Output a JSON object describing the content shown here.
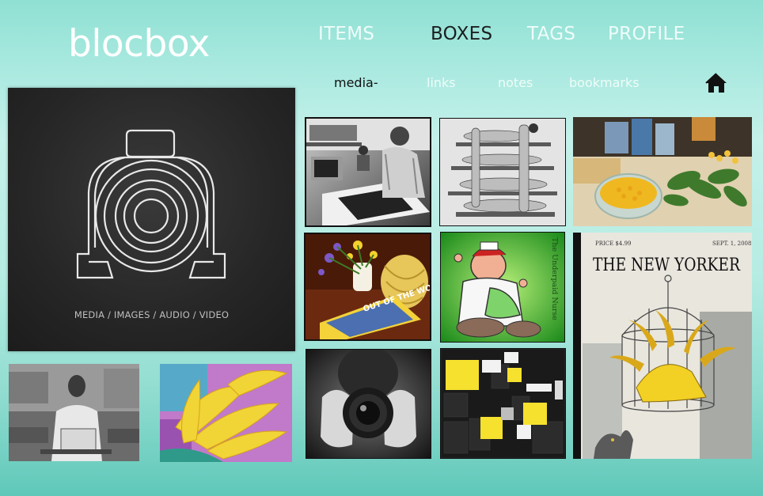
{
  "app": {
    "logo": "blocbox"
  },
  "nav": {
    "items": [
      {
        "label": "ITEMS",
        "active": false
      },
      {
        "label": "BOXES",
        "active": true
      },
      {
        "label": "TAGS",
        "active": false
      },
      {
        "label": "PROFILE",
        "active": false
      }
    ]
  },
  "subnav": {
    "items": [
      {
        "label": "media-",
        "active": true
      },
      {
        "label": "links",
        "active": false
      },
      {
        "label": "notes",
        "active": false
      },
      {
        "label": "bookmarks",
        "active": false
      }
    ],
    "home_icon": "home-icon"
  },
  "hero": {
    "icon": "camera-icon",
    "caption": "MEDIA / IMAGES / AUDIO / VIDEO"
  },
  "tiles": [
    {
      "name": "tile-printmaker-studio",
      "image": "artist-studio-photo"
    },
    {
      "name": "tile-body-shelf",
      "image": "figures-on-shelf-photo"
    },
    {
      "name": "tile-pasta-salad",
      "image": "food-photo"
    },
    {
      "name": "tile-flowers-book",
      "image": "flowers-and-book-photo",
      "text": "OUT OF THE WOODS"
    },
    {
      "name": "tile-underpaid-nurse",
      "image": "cartoon-nurse",
      "text": "The Underpaid Nurse"
    },
    {
      "name": "tile-new-yorker-cover",
      "image": "magazine-cover",
      "masthead": "THE NEW YORKER",
      "price": "PRICE $4.99",
      "date": "SEPT. 1, 2008"
    },
    {
      "name": "tile-laptop-man",
      "image": "man-with-laptop-photo"
    },
    {
      "name": "tile-yellow-flowers",
      "image": "yellow-petals-painting"
    },
    {
      "name": "tile-photographer",
      "image": "camera-lens-photo"
    },
    {
      "name": "tile-yellow-grid",
      "image": "abstract-squares"
    }
  ]
}
